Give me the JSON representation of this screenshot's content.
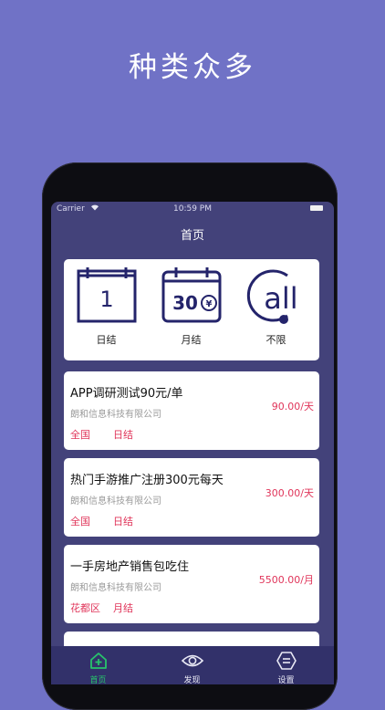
{
  "headline": "种类众多",
  "status": {
    "carrier": "Carrier",
    "time": "10:59 PM"
  },
  "nav": {
    "title": "首页"
  },
  "categories": [
    {
      "label": "日结",
      "icon": "calendar-day-icon",
      "icon_text": "1"
    },
    {
      "label": "月结",
      "icon": "calendar-month-icon",
      "icon_text": "30"
    },
    {
      "label": "不限",
      "icon": "all-icon",
      "icon_text": "all"
    }
  ],
  "jobs": [
    {
      "title": "APP调研测试90元/单",
      "company": "朗和信息科技有限公司",
      "area": "全国",
      "settle": "日结",
      "pay": "90.00/天"
    },
    {
      "title": "热门手游推广注册300元每天",
      "company": "朗和信息科技有限公司",
      "area": "全国",
      "settle": "日结",
      "pay": "300.00/天"
    },
    {
      "title": "一手房地产销售包吃住",
      "company": "朗和信息科技有限公司",
      "area": "花都区",
      "settle": "月结",
      "pay": "5500.00/月"
    }
  ],
  "tabs": [
    {
      "label": "首页",
      "icon": "home-icon"
    },
    {
      "label": "发现",
      "icon": "eye-icon"
    },
    {
      "label": "设置",
      "icon": "settings-icon"
    }
  ],
  "colors": {
    "background": "#7072c6",
    "screen": "#43427a",
    "accent_red": "#e0355a",
    "tab_active": "#27c46b",
    "icon_navy": "#24246b"
  }
}
